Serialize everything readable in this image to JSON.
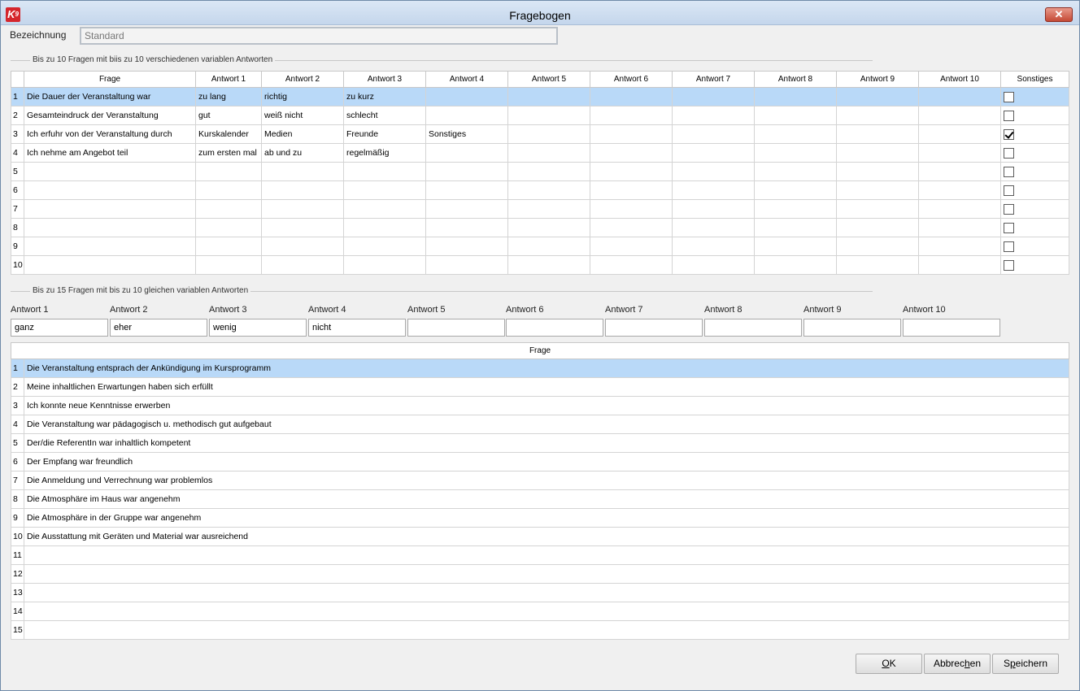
{
  "window": {
    "title": "Fragebogen"
  },
  "bezeichnung": {
    "label": "Bezeichnung",
    "value": "Standard"
  },
  "section1": {
    "title": "Bis zu 10 Fragen mit biis zu 10 verschiedenen variablen Antworten",
    "headers": [
      "Frage",
      "Antwort 1",
      "Antwort 2",
      "Antwort 3",
      "Antwort 4",
      "Antwort 5",
      "Antwort 6",
      "Antwort 7",
      "Antwort 8",
      "Antwort 9",
      "Antwort 10",
      "Sonstiges"
    ],
    "rows": [
      {
        "num": "1",
        "cells": [
          "Die Dauer der Veranstaltung war",
          "zu lang",
          "richtig",
          "zu kurz",
          "",
          "",
          "",
          "",
          "",
          "",
          ""
        ],
        "sonstiges": false,
        "selected": true
      },
      {
        "num": "2",
        "cells": [
          "Gesamteindruck der Veranstaltung",
          "gut",
          "weiß nicht",
          "schlecht",
          "",
          "",
          "",
          "",
          "",
          "",
          ""
        ],
        "sonstiges": false,
        "selected": false
      },
      {
        "num": "3",
        "cells": [
          "Ich erfuhr von der Veranstaltung durch",
          "Kurskalender",
          "Medien",
          "Freunde",
          "Sonstiges",
          "",
          "",
          "",
          "",
          "",
          ""
        ],
        "sonstiges": true,
        "selected": false
      },
      {
        "num": "4",
        "cells": [
          "Ich nehme am Angebot teil",
          "zum ersten mal",
          "ab und zu",
          "regelmäßig",
          "",
          "",
          "",
          "",
          "",
          "",
          ""
        ],
        "sonstiges": false,
        "selected": false
      },
      {
        "num": "5",
        "cells": [
          "",
          "",
          "",
          "",
          "",
          "",
          "",
          "",
          "",
          "",
          ""
        ],
        "sonstiges": false,
        "selected": false
      },
      {
        "num": "6",
        "cells": [
          "",
          "",
          "",
          "",
          "",
          "",
          "",
          "",
          "",
          "",
          ""
        ],
        "sonstiges": false,
        "selected": false
      },
      {
        "num": "7",
        "cells": [
          "",
          "",
          "",
          "",
          "",
          "",
          "",
          "",
          "",
          "",
          ""
        ],
        "sonstiges": false,
        "selected": false
      },
      {
        "num": "8",
        "cells": [
          "",
          "",
          "",
          "",
          "",
          "",
          "",
          "",
          "",
          "",
          ""
        ],
        "sonstiges": false,
        "selected": false
      },
      {
        "num": "9",
        "cells": [
          "",
          "",
          "",
          "",
          "",
          "",
          "",
          "",
          "",
          "",
          ""
        ],
        "sonstiges": false,
        "selected": false
      },
      {
        "num": "10",
        "cells": [
          "",
          "",
          "",
          "",
          "",
          "",
          "",
          "",
          "",
          "",
          ""
        ],
        "sonstiges": false,
        "selected": false
      }
    ]
  },
  "section2": {
    "title": "Bis zu 15 Fragen mit bis zu 10 gleichen variablen Antworten",
    "answers": [
      {
        "label": "Antwort 1",
        "value": "ganz"
      },
      {
        "label": "Antwort 2",
        "value": "eher"
      },
      {
        "label": "Antwort 3",
        "value": "wenig"
      },
      {
        "label": "Antwort 4",
        "value": "nicht"
      },
      {
        "label": "Antwort 5",
        "value": ""
      },
      {
        "label": "Antwort 6",
        "value": ""
      },
      {
        "label": "Antwort 7",
        "value": ""
      },
      {
        "label": "Antwort 8",
        "value": ""
      },
      {
        "label": "Antwort 9",
        "value": ""
      },
      {
        "label": "Antwort 10",
        "value": ""
      }
    ],
    "header": "Frage",
    "rows": [
      {
        "num": "1",
        "text": "Die Veranstaltung entsprach der Ankündigung im Kursprogramm",
        "selected": true
      },
      {
        "num": "2",
        "text": "Meine inhaltlichen Erwartungen haben sich erfüllt",
        "selected": false
      },
      {
        "num": "3",
        "text": "Ich konnte neue Kenntnisse erwerben",
        "selected": false
      },
      {
        "num": "4",
        "text": "Die Veranstaltung war pädagogisch u. methodisch gut aufgebaut",
        "selected": false
      },
      {
        "num": "5",
        "text": "Der/die ReferentIn war inhaltlich kompetent",
        "selected": false
      },
      {
        "num": "6",
        "text": "Der Empfang war freundlich",
        "selected": false
      },
      {
        "num": "7",
        "text": "Die Anmeldung und Verrechnung war problemlos",
        "selected": false
      },
      {
        "num": "8",
        "text": "Die Atmosphäre im Haus war angenehm",
        "selected": false
      },
      {
        "num": "9",
        "text": "Die Atmosphäre in der Gruppe war angenehm",
        "selected": false
      },
      {
        "num": "10",
        "text": "Die Ausstattung mit Geräten und Material war ausreichend",
        "selected": false
      },
      {
        "num": "11",
        "text": "",
        "selected": false
      },
      {
        "num": "12",
        "text": "",
        "selected": false
      },
      {
        "num": "13",
        "text": "",
        "selected": false
      },
      {
        "num": "14",
        "text": "",
        "selected": false
      },
      {
        "num": "15",
        "text": "",
        "selected": false
      }
    ]
  },
  "buttons": {
    "ok": {
      "pre": "",
      "u": "O",
      "post": "K"
    },
    "abbrechen": {
      "pre": "Abbrec",
      "u": "h",
      "post": "en"
    },
    "speichern": {
      "pre": "S",
      "u": "p",
      "post": "eichern"
    }
  }
}
